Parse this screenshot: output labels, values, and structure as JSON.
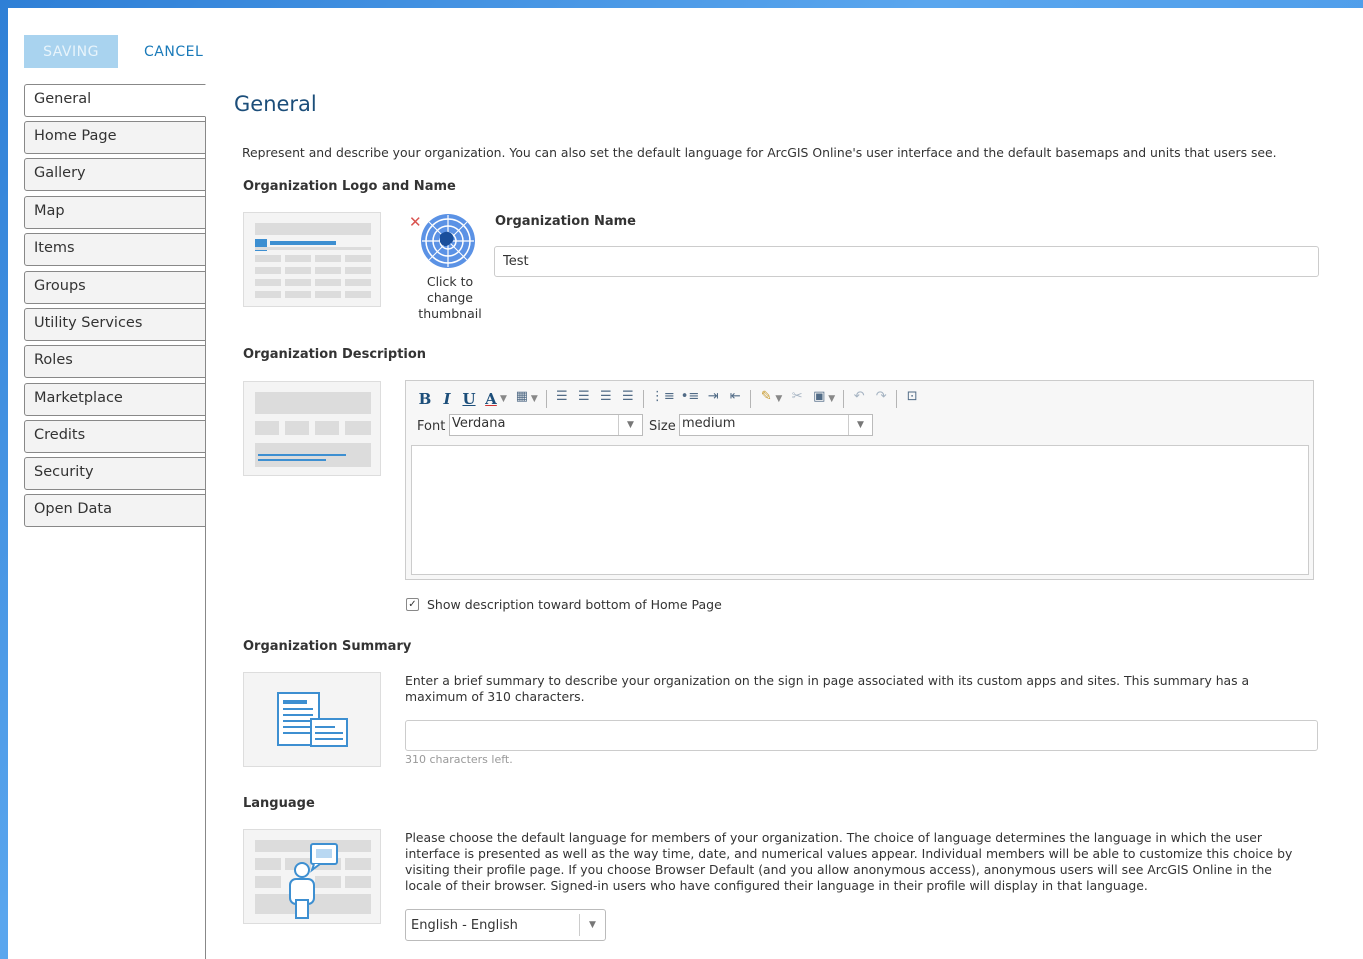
{
  "topbar": {
    "saving_label": "SAVING",
    "cancel_label": "CANCEL"
  },
  "sidebar": {
    "items": [
      {
        "label": "General"
      },
      {
        "label": "Home Page"
      },
      {
        "label": "Gallery"
      },
      {
        "label": "Map"
      },
      {
        "label": "Items"
      },
      {
        "label": "Groups"
      },
      {
        "label": "Utility Services"
      },
      {
        "label": "Roles"
      },
      {
        "label": "Marketplace"
      },
      {
        "label": "Credits"
      },
      {
        "label": "Security"
      },
      {
        "label": "Open Data"
      }
    ],
    "active_index": 0
  },
  "main": {
    "title": "General",
    "intro": "Represent and describe your organization. You can also set the default language for ArcGIS Online's user interface and the default basemaps and units that users see.",
    "logo_section": {
      "heading": "Organization Logo and Name",
      "thumbnail_caption_1": "Click to",
      "thumbnail_caption_2": "change",
      "thumbnail_caption_3": "thumbnail",
      "name_label": "Organization Name",
      "name_value": "Test"
    },
    "description_section": {
      "heading": "Organization Description",
      "font_label": "Font",
      "font_value": "Verdana",
      "size_label": "Size",
      "size_value": "medium",
      "show_bottom_label": "Show description toward bottom of Home Page",
      "show_bottom_checked": true
    },
    "summary_section": {
      "heading": "Organization Summary",
      "help_line_1": "Enter a brief summary to describe your organization on the sign in page associated with its custom apps and sites. This summary has a",
      "help_line_2": "maximum of 310 characters.",
      "value": "",
      "chars_left": "310 characters left."
    },
    "language_section": {
      "heading": "Language",
      "help_line_1": "Please choose the default language for members of your organization. The choice of language determines the language in which the user",
      "help_line_2": "interface is presented as well as the way time, date, and numerical values appear. Individual members will be able to customize this choice by",
      "help_line_3": "visiting their profile page. If you choose Browser Default (and you allow anonymous access), anonymous users will see ArcGIS Online in the",
      "help_line_4": "locale of their browser. Signed-in users who have configured their language in their profile will display in that language.",
      "selected": "English - English"
    }
  },
  "colors": {
    "accent": "#1a7ab9",
    "title": "#1c4e7a",
    "saving_bg": "#a9d3ef",
    "thumb_blue": "#3d8fd1"
  }
}
